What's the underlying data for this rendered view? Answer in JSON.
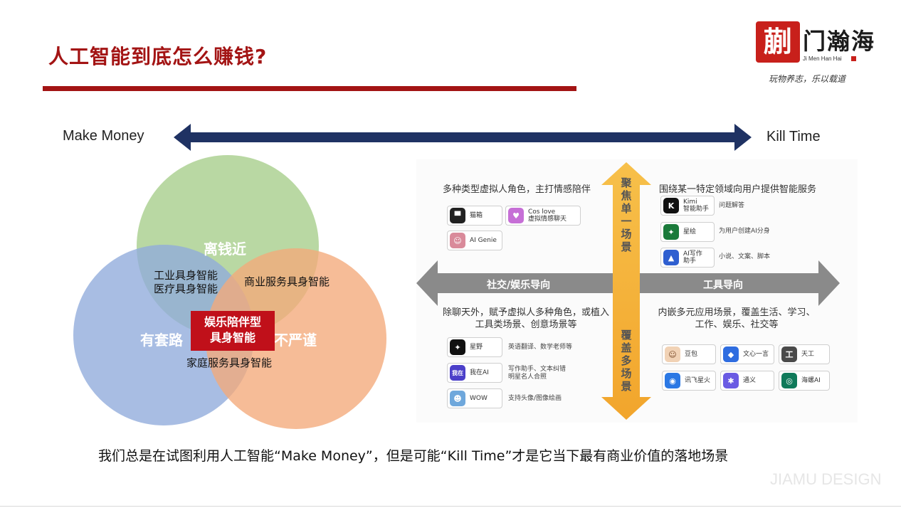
{
  "title": "人工智能到底怎么赚钱?",
  "logo": {
    "mark": "蒯",
    "name": "门瀚海",
    "english": "Ji Men Han Hai",
    "slogan": "玩物养志，乐以载道"
  },
  "axis": {
    "left": "Make Money",
    "right": "Kill Time",
    "color": "#1f3263"
  },
  "venn": {
    "circles": [
      {
        "label": "离钱近",
        "color": "#a9cf8f"
      },
      {
        "label": "有套路",
        "color": "#8fabdb"
      },
      {
        "label": "不严谨",
        "color": "#f3a97a"
      }
    ],
    "overlap_top_left": [
      "工业具身智能",
      "医疗具身智能"
    ],
    "overlap_top_right": "商业服务具身智能",
    "overlap_bottom": "家庭服务具身智能",
    "center": [
      "娱乐陪伴型",
      "具身智能"
    ]
  },
  "quadrant": {
    "vertical_top": "聚焦单一场景",
    "vertical_bottom": "覆盖多场景",
    "horizontal_left": "社交/娱乐导向",
    "horizontal_right": "工具导向",
    "top_left": {
      "heading": "多种类型虚拟人角色，主打情感陪伴",
      "apps": [
        {
          "name": "猫箱",
          "icon": "cat-box-icon",
          "color": "#222222"
        },
        {
          "name": "Cos love\n虚拟情感聊天",
          "icon": "cos-love-icon",
          "color": "#c66fd6"
        },
        {
          "name": "AI Genie",
          "icon": "ai-genie-icon",
          "color": "#d98a9a"
        }
      ]
    },
    "top_right": {
      "heading": "围绕某一特定领域向用户提供智能服务",
      "apps": [
        {
          "name": "Kimi\n智能助手",
          "caption": "问题解答",
          "icon": "kimi-icon",
          "color": "#111111"
        },
        {
          "name": "星绘",
          "caption": "为用户创建AI分身",
          "icon": "xinghui-icon",
          "color": "#1a7a3a"
        },
        {
          "name": "AI写作\n助手",
          "caption": "小说、文案、脚本",
          "icon": "ai-writing-icon",
          "color": "#2f5fd0"
        }
      ]
    },
    "bottom_left": {
      "heading": "除聊天外，赋予虚拟人多种角色，或植入工具类场景、创意场景等",
      "apps": [
        {
          "name": "星野",
          "caption": "英语翻译、数学老师等",
          "icon": "xingye-icon",
          "color": "#111111"
        },
        {
          "name": "我在AI",
          "caption": "写作助手、文本纠错\n明星名人合照",
          "icon": "wozai-icon",
          "color": "#4b3fc9",
          "glyph": "我在"
        },
        {
          "name": "WOW",
          "caption": "支持头像/图像绘画",
          "icon": "wow-icon",
          "color": "#6fa8dc"
        }
      ]
    },
    "bottom_right": {
      "heading": "内嵌多元应用场景，覆盖生活、学习、工作、娱乐、社交等",
      "apps": [
        {
          "name": "豆包",
          "icon": "doubao-icon",
          "color": "#f1d2b5"
        },
        {
          "name": "文心一言",
          "icon": "wenxin-icon",
          "color": "#2f6de0"
        },
        {
          "name": "天工",
          "icon": "tiangong-icon",
          "color": "#4a4a4a"
        },
        {
          "name": "讯飞星火",
          "icon": "xunfei-icon",
          "color": "#2b78e4"
        },
        {
          "name": "通义",
          "icon": "tongyi-icon",
          "color": "#6a5be3"
        },
        {
          "name": "海螺AI",
          "icon": "hailuo-icon",
          "color": "#0f7a5a"
        }
      ]
    }
  },
  "caption": "我们总是在试图利用人工智能“Make Money”，但是可能“Kill Time”才是它当下最有商业价值的落地场景",
  "watermark": "JIAMU DESIGN"
}
